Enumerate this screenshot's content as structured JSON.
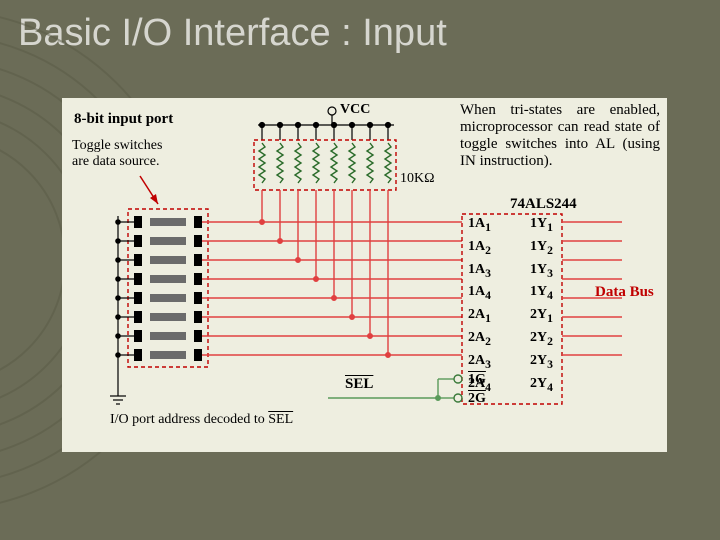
{
  "title": "Basic I/O Interface : Input",
  "port_label": "8-bit input port",
  "toggle_label_l1": "Toggle switches",
  "toggle_label_l2": "are data source.",
  "vcc": "VCC",
  "resistor_value": "10KΩ",
  "desc_text": "When tri-states are enabled, microprocessor can read state of toggle switches into AL (using IN instruction).",
  "chip_name": "74ALS244",
  "inputs": [
    "1A",
    "1A",
    "1A",
    "1A",
    "2A",
    "2A",
    "2A",
    "2A"
  ],
  "input_subs": [
    "1",
    "2",
    "3",
    "4",
    "1",
    "2",
    "3",
    "4"
  ],
  "outputs": [
    "1Y",
    "1Y",
    "1Y",
    "1Y",
    "2Y",
    "2Y",
    "2Y",
    "2Y"
  ],
  "output_subs": [
    "1",
    "2",
    "3",
    "4",
    "1",
    "2",
    "3",
    "4"
  ],
  "gates": [
    "1G",
    "2G"
  ],
  "data_bus": "Data Bus",
  "sel": "SEL",
  "decode_label_1": "I/O port address decoded to ",
  "decode_label_2": "SEL",
  "gate_bar1": "1G",
  "gate_bar2": "2G"
}
